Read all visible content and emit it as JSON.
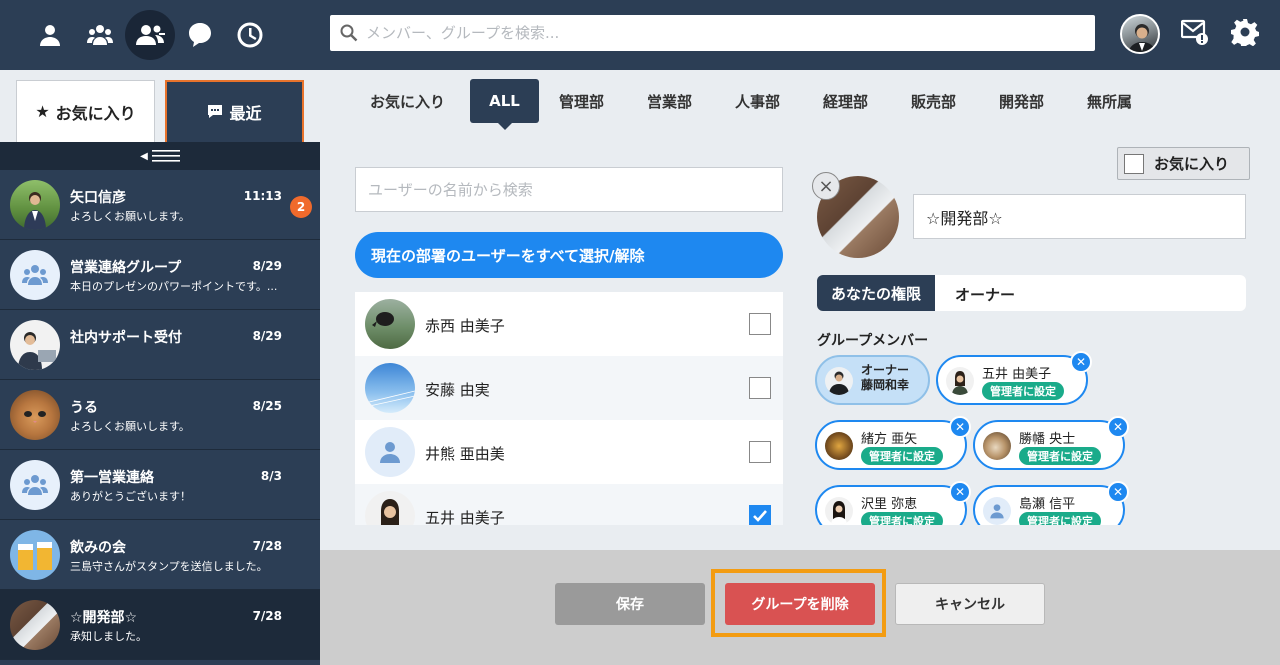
{
  "topbar": {
    "nav_icons": [
      "person-icon",
      "group-icon",
      "contacts-icon",
      "chat-bubble-icon",
      "clock-icon"
    ],
    "active_nav": "contacts-icon",
    "search_placeholder": "メンバー、グループを検索..."
  },
  "left_tabs": {
    "favorites": "お気に入り",
    "recent": "最近",
    "active": "recent"
  },
  "chats": [
    {
      "name": "矢口信彦",
      "preview": "よろしくお願いします。",
      "time": "11:13",
      "badge": "2",
      "avatar": "photo"
    },
    {
      "name": "営業連絡グループ",
      "preview": "本日のプレゼンのパワーポイントです。...",
      "time": "8/29",
      "badge": "",
      "avatar": "group"
    },
    {
      "name": "社内サポート受付",
      "preview": "",
      "time": "8/29",
      "badge": "",
      "avatar": "photo"
    },
    {
      "name": "うる",
      "preview": "よろしくお願いします。",
      "time": "8/25",
      "badge": "",
      "avatar": "cat"
    },
    {
      "name": "第一営業連絡",
      "preview": "ありがとうございます！",
      "time": "8/3",
      "badge": "",
      "avatar": "group"
    },
    {
      "name": "飲みの会",
      "preview": "三島守さんがスタンプを送信しました。",
      "time": "7/28",
      "badge": "",
      "avatar": "beer"
    },
    {
      "name": "☆開発部☆",
      "preview": "承知しました。",
      "time": "7/28",
      "badge": "",
      "avatar": "laptop"
    }
  ],
  "dept_tabs": [
    "お気に入り",
    "ALL",
    "管理部",
    "営業部",
    "人事部",
    "経理部",
    "販売部",
    "開発部",
    "無所属"
  ],
  "active_dept": "ALL",
  "user_search_placeholder": "ユーザーの名前から検索",
  "select_all_label": "現在の部署のユーザーをすべて選択/解除",
  "users": [
    {
      "name": "赤西 由美子",
      "checked": false,
      "avatar": "dog"
    },
    {
      "name": "安藤 由実",
      "checked": false,
      "avatar": "sky"
    },
    {
      "name": "井熊 亜由美",
      "checked": false,
      "avatar": "default"
    },
    {
      "name": "五井 由美子",
      "checked": true,
      "avatar": "woman"
    }
  ],
  "group": {
    "favorite_label": "お気に入り",
    "name": "☆開発部☆",
    "permission_label": "あなたの権限",
    "permission_value": "オーナー",
    "members_title": "グループメンバー"
  },
  "members": [
    {
      "role": "オーナー",
      "name": "藤岡和幸",
      "owner": true,
      "badge": ""
    },
    {
      "role": "",
      "name": "五井 由美子",
      "owner": false,
      "badge": "管理者に設定"
    },
    {
      "role": "",
      "name": "緒方 亜矢",
      "owner": false,
      "badge": "管理者に設定"
    },
    {
      "role": "",
      "name": "勝幡 央士",
      "owner": false,
      "badge": "管理者に設定"
    },
    {
      "role": "",
      "name": "沢里 弥恵",
      "owner": false,
      "badge": "管理者に設定"
    },
    {
      "role": "",
      "name": "島瀬 信平",
      "owner": false,
      "badge": "管理者に設定"
    }
  ],
  "footer": {
    "save": "保存",
    "delete": "グループを削除",
    "cancel": "キャンセル"
  },
  "colors": {
    "navy": "#2c3e55",
    "accent_blue": "#1e88f0",
    "delete_red": "#d95252",
    "highlight": "#f39c12",
    "badge_orange": "#f06a2c",
    "admin_green": "#1aab8a"
  }
}
